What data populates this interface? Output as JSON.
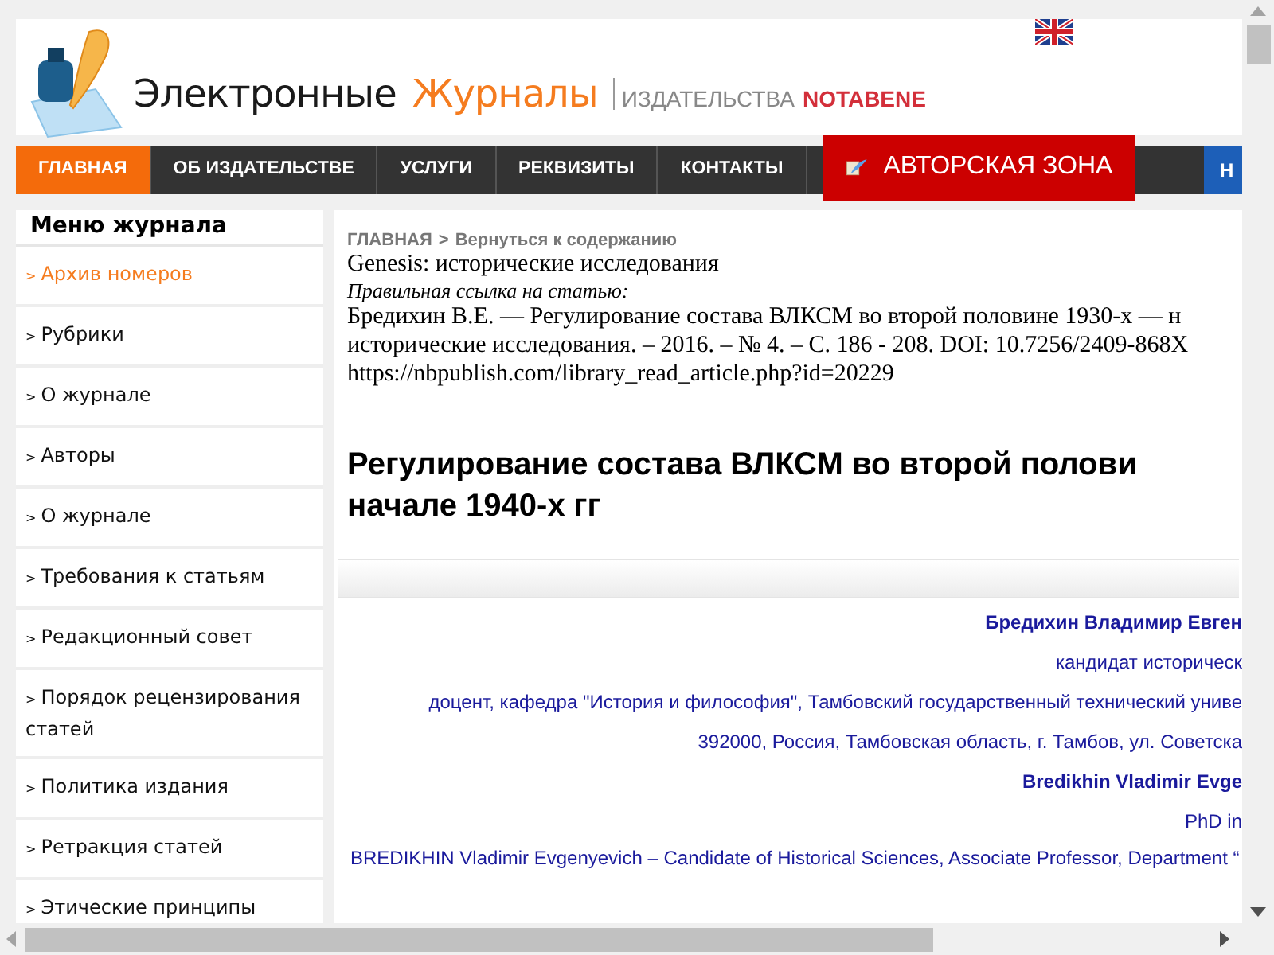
{
  "header": {
    "logo_words": [
      {
        "text": "Электронные",
        "kind": "dark"
      },
      {
        "text": "Журналы",
        "kind": "accent"
      }
    ],
    "publisher_label": "ИЗДАТЕЛЬСТВА",
    "publisher_name": "NOTABENE"
  },
  "nav": {
    "items": [
      {
        "label": "ГЛАВНАЯ",
        "selected": true
      },
      {
        "label": "ОБ ИЗДАТЕЛЬСТВЕ",
        "selected": false
      },
      {
        "label": "УСЛУГИ",
        "selected": false
      },
      {
        "label": "РЕКВИЗИТЫ",
        "selected": false
      },
      {
        "label": "КОНТАКТЫ",
        "selected": false
      }
    ],
    "author_zone": "АВТОРСКАЯ ЗОНА",
    "cut_item": "Н"
  },
  "sidebar": {
    "title": "Меню журнала",
    "items": [
      {
        "marker": ">",
        "label": "Архив номеров",
        "selected": true
      },
      {
        "marker": ">",
        "label": "Рубрики",
        "selected": false
      },
      {
        "marker": ">",
        "label": "О журнале",
        "selected": false
      },
      {
        "marker": ">",
        "label": "Авторы",
        "selected": false
      },
      {
        "marker": ">",
        "label": "О журнале",
        "selected": false
      },
      {
        "marker": ">",
        "label": "Требования к статьям",
        "selected": false
      },
      {
        "marker": ">",
        "label": "Редакционный совет",
        "selected": false
      },
      {
        "marker": ">",
        "label": "Порядок рецензирования статей",
        "selected": false
      },
      {
        "marker": ">",
        "label": "Политика издания",
        "selected": false
      },
      {
        "marker": ">",
        "label": "Ретракция статей",
        "selected": false
      },
      {
        "marker": ">",
        "label": "Этические принципы",
        "selected": false
      }
    ]
  },
  "breadcrumb": {
    "home": "ГЛАВНАЯ",
    "separator": ">",
    "back": "Вернуться к содержанию"
  },
  "journal": "Genesis: исторические исследования",
  "citation_label": "Правильная ссылка на статью:",
  "citation_lines": [
    "Бредихин В.Е. — Регулирование состава ВЛКСМ во второй половине 1930-х — н",
    "исторические исследования. – 2016. – № 4. – С. 186 - 208. DOI: 10.7256/2409-868X",
    "https://nbpublish.com/library_read_article.php?id=20229"
  ],
  "title_lines": [
    "Регулирование состава ВЛКСМ во второй полови",
    "начале 1940-х гг"
  ],
  "authors": [
    {
      "text": "Бредихин Владимир Евген",
      "kind": "name"
    },
    {
      "text": "кандидат историческ",
      "kind": "info"
    },
    {
      "text": "доцент, кафедра \"История и философия\", Тамбовский государственный технический униве",
      "kind": "info"
    },
    {
      "text": "392000, Россия, Тамбовская область, г. Тамбов, ул. Советска",
      "kind": "info"
    },
    {
      "text": "Bredikhin Vladimir Evge",
      "kind": "name"
    },
    {
      "text": "PhD in",
      "kind": "info"
    }
  ],
  "abstract_start": "BREDIKHIN Vladimir Evgenyevich – Candidate of Historical Sciences, Associate Professor, Department “"
}
